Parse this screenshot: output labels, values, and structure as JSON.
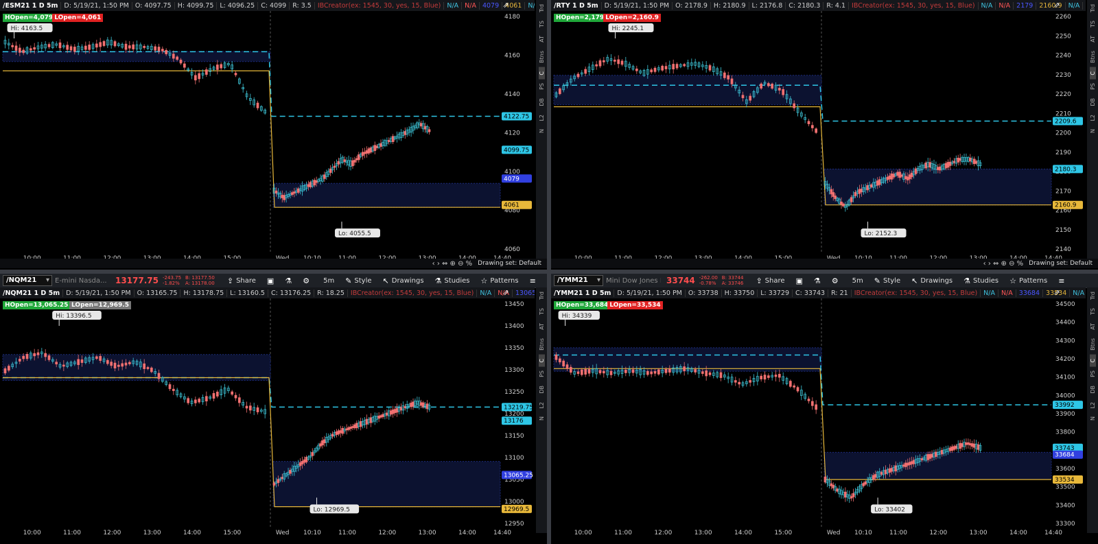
{
  "layout_grid": "2x2",
  "drawing_set_label": "Drawing set: Default",
  "side_tabs": [
    "Trd",
    "TS",
    "AT",
    "Btns",
    "C",
    "PS",
    "DB",
    "L2",
    "N"
  ],
  "panes": [
    {
      "id": "es",
      "symbol_toolbar": null,
      "info": {
        "title": "/ESM21 1 D 5m",
        "date": "D: 5/19/21, 1:50 PM",
        "open": "O: 4097.75",
        "high": "H: 4099.75",
        "low": "L: 4096.25",
        "close": "C: 4099",
        "range": "R: 3.5",
        "indicator": "IBCreator(ex: 1545, 30, yes, 15, Blue)",
        "vals": [
          "N/A",
          "N/A",
          "4079",
          "4061",
          "N/A",
          "N/A",
          "N/A"
        ]
      },
      "hopen": "HOpen=4,079",
      "lopen": "LOpen=4,061",
      "hi_label": "Hi: 4163.5",
      "lo_label": "Lo: 4055.5",
      "y_ticks": [
        "4180",
        "4160",
        "4140",
        "4120",
        "4100",
        "4080",
        "4060"
      ],
      "price_tags": [
        {
          "text": "4122.75",
          "color": "#2ec6e6",
          "fg": "#000"
        },
        {
          "text": "4099.75",
          "color": "#2ec6e6",
          "fg": "#000"
        },
        {
          "text": "4079",
          "color": "#3140e0",
          "fg": "#fff"
        },
        {
          "text": "4061",
          "color": "#e8b83a",
          "fg": "#000"
        }
      ],
      "x_ticks": [
        "10:00",
        "11:00",
        "12:00",
        "13:00",
        "14:00",
        "15:00",
        "Wed",
        "10:10",
        "11:00",
        "12:00",
        "13:00",
        "14:00",
        "14:40"
      ]
    },
    {
      "id": "rty",
      "symbol_toolbar": null,
      "info": {
        "title": "/RTY 1 D 5m",
        "date": "D: 5/19/21, 1:50 PM",
        "open": "O: 2178.9",
        "high": "H: 2180.9",
        "low": "L: 2176.8",
        "close": "C: 2180.3",
        "range": "R: 4.1",
        "indicator": "IBCreator(ex: 1545, 30, yes, 15, Blue)",
        "vals": [
          "N/A",
          "N/A",
          "2179",
          "2160.9",
          "N/A",
          "N/A"
        ]
      },
      "hopen": "HOpen=2,179",
      "lopen": "LOpen=2,160.9",
      "hi_label": "Hi: 2245.1",
      "lo_label": "Lo: 2152.3",
      "y_ticks": [
        "2260",
        "2250",
        "2240",
        "2230",
        "2220",
        "2210",
        "2200",
        "2190",
        "2180",
        "2170",
        "2160",
        "2150",
        "2140"
      ],
      "price_tags": [
        {
          "text": "2209.6",
          "color": "#2ec6e6",
          "fg": "#000"
        },
        {
          "text": "2180.3",
          "color": "#2ec6e6",
          "fg": "#000"
        },
        {
          "text": "2160.9",
          "color": "#e8b83a",
          "fg": "#000"
        }
      ],
      "x_ticks": [
        "10:00",
        "11:00",
        "12:00",
        "13:00",
        "14:00",
        "15:00",
        "Wed",
        "10:10",
        "11:00",
        "12:00",
        "13:00",
        "14:00",
        "14:40"
      ]
    },
    {
      "id": "nq",
      "symbol_toolbar": {
        "symbol": "/NQM21",
        "desc": "E-mini Nasda...",
        "last": "13177.75",
        "chg": [
          "-243.75",
          "-1.82%"
        ],
        "bidask": [
          "B: 13177.50",
          "A: 13178.00"
        ],
        "share": "Share",
        "period": "5m",
        "style": "Style",
        "drawings": "Drawings",
        "studies": "Studies",
        "patterns": "Patterns"
      },
      "info": {
        "title": "/NQM21 1 D 5m",
        "date": "D: 5/19/21, 1:50 PM",
        "open": "O: 13165.75",
        "high": "H: 13178.75",
        "low": "L: 13160.5",
        "close": "C: 13176.25",
        "range": "R: 18.25",
        "indicator": "IBCreator(ex: 1545, 30, yes, 15, Blue)",
        "vals": [
          "N/A",
          "N/A",
          "13065.25"
        ]
      },
      "hopen": "HOpen=13,065.25",
      "lopen": "LOpen=12,969.5",
      "hi_label": "Hi: 13396.5",
      "lo_label": "Lo: 12969.5",
      "y_ticks": [
        "13450",
        "13400",
        "13350",
        "13300",
        "13250",
        "13200",
        "13150",
        "13100",
        "13050",
        "13000",
        "12950"
      ],
      "price_tags": [
        {
          "text": "13219.75",
          "color": "#2ec6e6",
          "fg": "#000"
        },
        {
          "text": "13176",
          "color": "#2ec6e6",
          "fg": "#000"
        },
        {
          "text": "13065.25",
          "color": "#3140e0",
          "fg": "#fff"
        },
        {
          "text": "12969.5",
          "color": "#e8b83a",
          "fg": "#000"
        }
      ],
      "x_ticks": [
        "10:00",
        "11:00",
        "12:00",
        "13:00",
        "14:00",
        "15:00",
        "Wed",
        "10:10",
        "11:00",
        "12:00",
        "13:00",
        "14:00",
        "14:40"
      ]
    },
    {
      "id": "ym",
      "symbol_toolbar": {
        "symbol": "/YMM21",
        "desc": "Mini Dow Jones Ind...",
        "last": "33744",
        "chg": [
          "-262.00",
          "-0.78%"
        ],
        "bidask": [
          "B: 33744",
          "A: 33746"
        ],
        "share": "Share",
        "period": "5m",
        "style": "Style",
        "drawings": "Drawings",
        "studies": "Studies",
        "patterns": "Patterns"
      },
      "info": {
        "title": "/YMM21 1 D 5m",
        "date": "D: 5/19/21, 1:50 PM",
        "open": "O: 33738",
        "high": "H: 33750",
        "low": "L: 33729",
        "close": "C: 33743",
        "range": "R: 21",
        "indicator": "IBCreator(ex: 1545, 30, yes, 15, Blue)",
        "vals": [
          "N/A",
          "N/A",
          "33684",
          "33534",
          "N/A",
          "N/A",
          "N/A"
        ]
      },
      "hopen": "HOpen=33,684",
      "lopen": "LOpen=33,534",
      "hi_label": "Hi: 34339",
      "lo_label": "Lo: 33402",
      "y_ticks": [
        "34500",
        "34400",
        "34300",
        "34200",
        "34100",
        "34000",
        "33900",
        "33800",
        "33700",
        "33600",
        "33500",
        "33400",
        "33300"
      ],
      "price_tags": [
        {
          "text": "33992",
          "color": "#2ec6e6",
          "fg": "#000"
        },
        {
          "text": "33743",
          "color": "#2ec6e6",
          "fg": "#000"
        },
        {
          "text": "33684",
          "color": "#3140e0",
          "fg": "#fff"
        },
        {
          "text": "33534",
          "color": "#e8b83a",
          "fg": "#000"
        }
      ],
      "x_ticks": [
        "10:00",
        "11:00",
        "12:00",
        "13:00",
        "14:00",
        "15:00",
        "Wed",
        "10:10",
        "11:00",
        "12:00",
        "13:00",
        "14:00",
        "14:40"
      ]
    }
  ],
  "colors": {
    "up_candle": "#3ec6d9",
    "down_candle": "#f07070",
    "ib_line": "#2ec6e6",
    "lopen_line": "#e8b83a",
    "ib_fill": "#0c1230"
  }
}
